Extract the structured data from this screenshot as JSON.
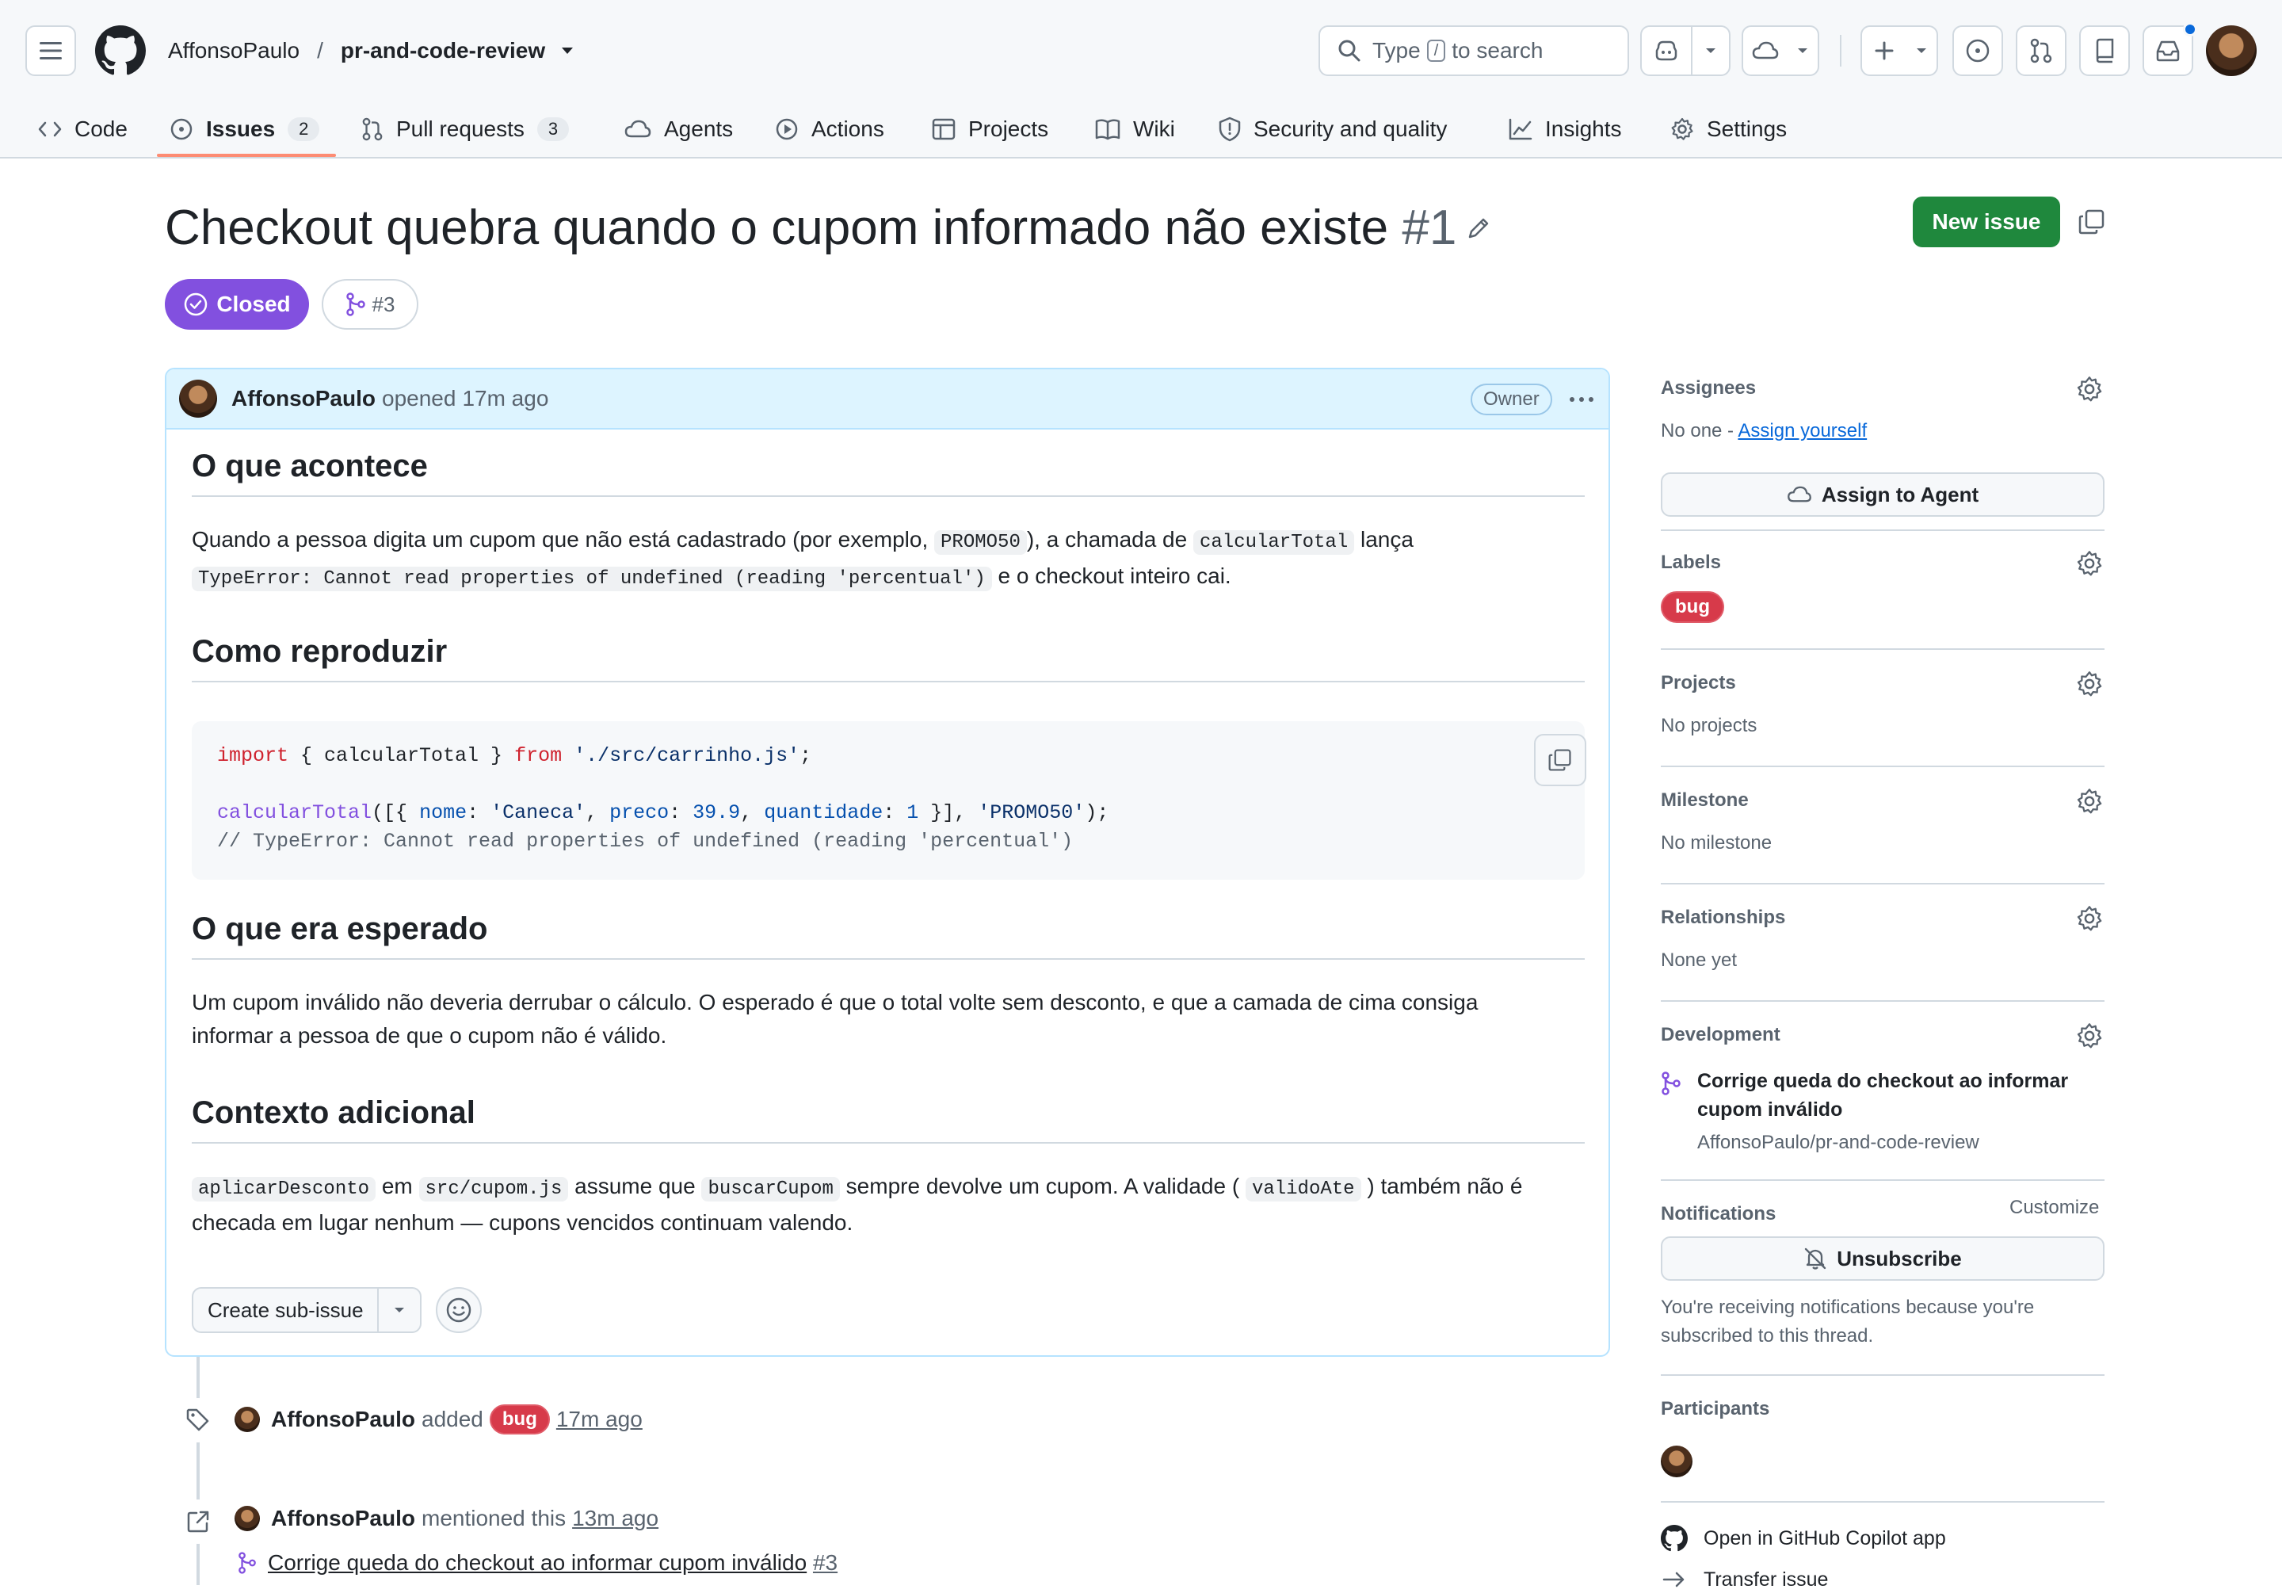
{
  "header": {
    "owner": "AffonsoPaulo",
    "separator": "/",
    "repo": "pr-and-code-review",
    "search": {
      "prefix": "Type",
      "key": "/",
      "suffix": "to search"
    }
  },
  "repo_nav": {
    "tabs": [
      {
        "label": "Code",
        "icon": "code-icon"
      },
      {
        "label": "Issues",
        "icon": "issue-opened-icon",
        "count": "2",
        "active": true
      },
      {
        "label": "Pull requests",
        "icon": "git-pull-request-icon",
        "count": "3"
      },
      {
        "label": "Agents",
        "icon": "agent-icon"
      },
      {
        "label": "Actions",
        "icon": "play-icon"
      },
      {
        "label": "Projects",
        "icon": "table-icon"
      },
      {
        "label": "Wiki",
        "icon": "book-icon"
      },
      {
        "label": "Security and quality",
        "icon": "shield-icon"
      },
      {
        "label": "Insights",
        "icon": "graph-icon"
      },
      {
        "label": "Settings",
        "icon": "gear-icon"
      }
    ]
  },
  "issue": {
    "title": "Checkout quebra quando o cupom informado não existe",
    "number": "#1",
    "state": "Closed",
    "linked_pr": "#3",
    "new_issue_label": "New issue"
  },
  "comment": {
    "author": "AffonsoPaulo",
    "action": "opened",
    "time": "17m ago",
    "role": "Owner",
    "sections": {
      "s1_heading": "O que acontece",
      "s1_p1_a": "Quando a pessoa digita um cupom que não está cadastrado (por exemplo,",
      "s1_p1_code1": "PROMO50",
      "s1_p1_b": "), a chamada de",
      "s1_p1_code2": "calcularTotal",
      "s1_p1_c": "lança",
      "s1_p1_code3": "TypeError: Cannot read properties of undefined (reading 'percentual')",
      "s1_p1_d": "e o checkout inteiro cai.",
      "s2_heading": "Como reproduzir",
      "code": {
        "line1_kw1": "import",
        "line1_mid": " { calcularTotal } ",
        "line1_kw2": "from",
        "line1_str": "'./src/carrinho.js'",
        "line1_end": ";",
        "line2_fn": "calcularTotal",
        "line2_a": "([{ ",
        "line2_p1": "nome",
        "line2_b": ": ",
        "line2_s1": "'Caneca'",
        "line2_c": ", ",
        "line2_p2": "preco",
        "line2_d": ": ",
        "line2_n1": "39.9",
        "line2_e": ", ",
        "line2_p3": "quantidade",
        "line2_f": ": ",
        "line2_n2": "1",
        "line2_g": " }], ",
        "line2_s2": "'PROMO50'",
        "line2_h": ");",
        "line3_comment": "// TypeError: Cannot read properties of undefined (reading 'percentual')"
      },
      "s3_heading": "O que era esperado",
      "s3_p1_line1": "Um cupom inválido não deveria derrubar o cálculo. O esperado é que o total volte sem desconto, e que a camada de cima consiga",
      "s3_p1_line2": "informar a pessoa de que o cupom não é válido.",
      "s4_heading": "Contexto adicional",
      "s4_code1": "aplicarDesconto",
      "s4_a": "em",
      "s4_code2": "src/cupom.js",
      "s4_b": "assume que",
      "s4_code3": "buscarCupom",
      "s4_c": "sempre devolve um cupom. A validade (",
      "s4_code4": "validoAte",
      "s4_d": ") também não é",
      "s4_line2": "checada em lugar nenhum — cupons vencidos continuam valendo."
    },
    "create_subissue": "Create sub-issue"
  },
  "timeline": {
    "event1": {
      "author": "AffonsoPaulo",
      "action": "added",
      "label": "bug",
      "time": "17m ago"
    },
    "event2": {
      "author": "AffonsoPaulo",
      "action": "mentioned this",
      "time": "13m ago",
      "ref_title": "Corrige queda do checkout ao informar cupom inválido",
      "ref_number": "#3"
    }
  },
  "sidebar": {
    "assignees": {
      "title": "Assignees",
      "none": "No one -",
      "assign_self": "Assign yourself",
      "agent_button": "Assign to Agent"
    },
    "labels": {
      "title": "Labels",
      "label": "bug"
    },
    "projects": {
      "title": "Projects",
      "text": "No projects"
    },
    "milestone": {
      "title": "Milestone",
      "text": "No milestone"
    },
    "relationships": {
      "title": "Relationships",
      "text": "None yet"
    },
    "development": {
      "title": "Development",
      "item_title": "Corrige queda do checkout ao informar cupom inválido",
      "item_repo": "AffonsoPaulo/pr-and-code-review"
    },
    "notifications": {
      "title": "Notifications",
      "customize": "Customize",
      "button": "Unsubscribe",
      "reason": "You're receiving notifications because you're subscribed to this thread."
    },
    "participants": {
      "title": "Participants"
    },
    "open_copilot": "Open in GitHub Copilot app",
    "transfer": "Transfer issue"
  },
  "colors": {
    "closed": "#8250df",
    "primary": "#1f883d",
    "bug_label": "#d73a4a",
    "tab_underline": "#fd8c73",
    "link": "#0969da"
  }
}
